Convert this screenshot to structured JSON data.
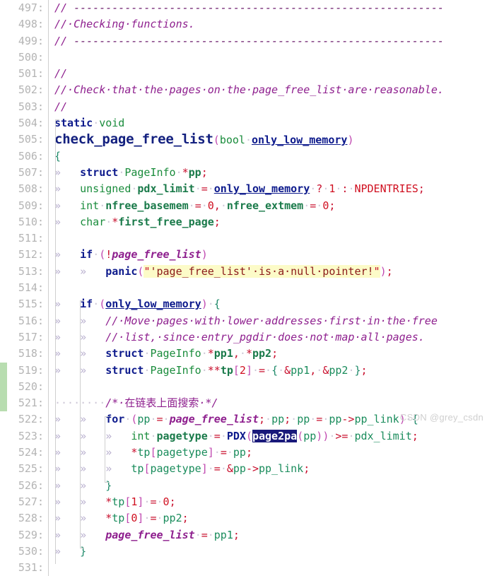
{
  "app": {
    "kind": "code-editor",
    "language": "C",
    "watermark": "CSDN @grey_csdn",
    "theme": {
      "background": "#ffffff",
      "line_number_color": "#b4b4b4",
      "comment_color": "#8e1f8e",
      "keyword_color": "#0d1a8c",
      "type_color": "#1a8c3c",
      "macro_color": "#d01020",
      "string_color": "#8b1a1a",
      "string_background": "#fcfbc8",
      "selection_background": "#19197a",
      "selection_foreground": "#ffffff",
      "change_marker_color": "#b8ddb0",
      "tab_glyph_color": "#b9b0cf"
    },
    "selection": {
      "text": "page2pa",
      "line": 523
    },
    "whitespace_visible": true,
    "tab_glyph": "»",
    "space_glyph": "·"
  },
  "gutter": {
    "first_line": 497,
    "last_line": 531,
    "separator": ":"
  },
  "change_markers": [
    {
      "from_line": 519,
      "to_line": 521
    }
  ],
  "lines": [
    {
      "n": 497,
      "tokens": [
        {
          "t": "// ",
          "c": "cm"
        },
        {
          "t": "----------------------------------------------------------",
          "c": "cm-dash"
        }
      ]
    },
    {
      "n": 498,
      "tokens": [
        {
          "t": "//·Checking·functions.",
          "c": "cm"
        }
      ]
    },
    {
      "n": 499,
      "tokens": [
        {
          "t": "// ",
          "c": "cm"
        },
        {
          "t": "----------------------------------------------------------",
          "c": "cm-dash"
        }
      ]
    },
    {
      "n": 500,
      "tokens": []
    },
    {
      "n": 501,
      "tokens": [
        {
          "t": "//",
          "c": "cm"
        }
      ]
    },
    {
      "n": 502,
      "tokens": [
        {
          "t": "//·Check·that·the·pages·on·the·page_free_list·are·reasonable.",
          "c": "cm"
        }
      ]
    },
    {
      "n": 503,
      "tokens": [
        {
          "t": "//",
          "c": "cm"
        }
      ]
    },
    {
      "n": 504,
      "tokens": [
        {
          "t": "static",
          "c": "kw"
        },
        {
          "t": "·",
          "c": "dot"
        },
        {
          "t": "void",
          "c": "ty"
        }
      ]
    },
    {
      "n": 505,
      "big": true,
      "tokens": [
        {
          "t": "check_page_free_list",
          "c": "fnbig"
        },
        {
          "t": "(",
          "c": "pn"
        },
        {
          "t": "bool",
          "c": "ty"
        },
        {
          "t": "·",
          "c": "dot"
        },
        {
          "t": "only_low_memory",
          "c": "pm"
        },
        {
          "t": ")",
          "c": "pn"
        }
      ]
    },
    {
      "n": 506,
      "tokens": [
        {
          "t": "{",
          "c": "br"
        }
      ]
    },
    {
      "n": 507,
      "indent": 1,
      "tokens": [
        {
          "t": "struct",
          "c": "kw"
        },
        {
          "t": "·",
          "c": "dot"
        },
        {
          "t": "PageInfo",
          "c": "ty"
        },
        {
          "t": "·",
          "c": "dot"
        },
        {
          "t": "*",
          "c": "op"
        },
        {
          "t": "pp",
          "c": "vr"
        },
        {
          "t": ";",
          "c": "op"
        }
      ]
    },
    {
      "n": 508,
      "indent": 1,
      "tokens": [
        {
          "t": "unsigned",
          "c": "ty"
        },
        {
          "t": "·",
          "c": "dot"
        },
        {
          "t": "pdx_limit",
          "c": "vr"
        },
        {
          "t": "·",
          "c": "dot"
        },
        {
          "t": "=",
          "c": "op"
        },
        {
          "t": "·",
          "c": "dot"
        },
        {
          "t": "only_low_memory",
          "c": "pm"
        },
        {
          "t": "·",
          "c": "dot"
        },
        {
          "t": "?",
          "c": "op"
        },
        {
          "t": "·",
          "c": "dot"
        },
        {
          "t": "1",
          "c": "num"
        },
        {
          "t": "·",
          "c": "dot"
        },
        {
          "t": ":",
          "c": "op"
        },
        {
          "t": "·",
          "c": "dot"
        },
        {
          "t": "NPDENTRIES",
          "c": "mac"
        },
        {
          "t": ";",
          "c": "op"
        }
      ]
    },
    {
      "n": 509,
      "indent": 1,
      "tokens": [
        {
          "t": "int",
          "c": "ty"
        },
        {
          "t": "·",
          "c": "dot"
        },
        {
          "t": "nfree_basemem",
          "c": "vr"
        },
        {
          "t": "·",
          "c": "dot"
        },
        {
          "t": "=",
          "c": "op"
        },
        {
          "t": "·",
          "c": "dot"
        },
        {
          "t": "0",
          "c": "num"
        },
        {
          "t": ",",
          "c": "op"
        },
        {
          "t": "·",
          "c": "dot"
        },
        {
          "t": "nfree_extmem",
          "c": "vr"
        },
        {
          "t": "·",
          "c": "dot"
        },
        {
          "t": "=",
          "c": "op"
        },
        {
          "t": "·",
          "c": "dot"
        },
        {
          "t": "0",
          "c": "num"
        },
        {
          "t": ";",
          "c": "op"
        }
      ]
    },
    {
      "n": 510,
      "indent": 1,
      "tokens": [
        {
          "t": "char",
          "c": "ty"
        },
        {
          "t": "·",
          "c": "dot"
        },
        {
          "t": "*",
          "c": "op"
        },
        {
          "t": "first_free_page",
          "c": "vr"
        },
        {
          "t": ";",
          "c": "op"
        }
      ]
    },
    {
      "n": 511,
      "tokens": []
    },
    {
      "n": 512,
      "indent": 1,
      "tokens": [
        {
          "t": "if",
          "c": "kw"
        },
        {
          "t": "·",
          "c": "dot"
        },
        {
          "t": "(",
          "c": "pn"
        },
        {
          "t": "!",
          "c": "op"
        },
        {
          "t": "page_free_list",
          "c": "gv"
        },
        {
          "t": ")",
          "c": "pn"
        }
      ]
    },
    {
      "n": 513,
      "indent": 2,
      "tokens": [
        {
          "t": "panic",
          "c": "fn"
        },
        {
          "t": "(",
          "c": "pn"
        },
        {
          "t": "\"",
          "c": "strq"
        },
        {
          "t": "'page_free_list'·is·a·null·pointer!",
          "c": "str"
        },
        {
          "t": "\"",
          "c": "strq"
        },
        {
          "t": ")",
          "c": "pn"
        },
        {
          "t": ";",
          "c": "op"
        }
      ]
    },
    {
      "n": 514,
      "tokens": []
    },
    {
      "n": 515,
      "indent": 1,
      "tokens": [
        {
          "t": "if",
          "c": "kw"
        },
        {
          "t": "·",
          "c": "dot"
        },
        {
          "t": "(",
          "c": "pn"
        },
        {
          "t": "only_low_memory",
          "c": "pm"
        },
        {
          "t": ")",
          "c": "pn"
        },
        {
          "t": "·",
          "c": "dot"
        },
        {
          "t": "{",
          "c": "br"
        }
      ]
    },
    {
      "n": 516,
      "indent": 2,
      "tokens": [
        {
          "t": "//·Move·pages·with·lower·addresses·first·in·the·free",
          "c": "cm"
        }
      ]
    },
    {
      "n": 517,
      "indent": 2,
      "tokens": [
        {
          "t": "//·list,·since·entry_pgdir·does·not·map·all·pages.",
          "c": "cm"
        }
      ]
    },
    {
      "n": 518,
      "indent": 2,
      "tokens": [
        {
          "t": "struct",
          "c": "kw"
        },
        {
          "t": "·",
          "c": "dot"
        },
        {
          "t": "PageInfo",
          "c": "ty"
        },
        {
          "t": "·",
          "c": "dot"
        },
        {
          "t": "*",
          "c": "op"
        },
        {
          "t": "pp1",
          "c": "vr"
        },
        {
          "t": ",",
          "c": "op"
        },
        {
          "t": "·",
          "c": "dot"
        },
        {
          "t": "*",
          "c": "op"
        },
        {
          "t": "pp2",
          "c": "vr"
        },
        {
          "t": ";",
          "c": "op"
        }
      ]
    },
    {
      "n": 519,
      "indent": 2,
      "tokens": [
        {
          "t": "struct",
          "c": "kw"
        },
        {
          "t": "·",
          "c": "dot"
        },
        {
          "t": "PageInfo",
          "c": "ty"
        },
        {
          "t": "·",
          "c": "dot"
        },
        {
          "t": "**",
          "c": "op"
        },
        {
          "t": "tp",
          "c": "vr"
        },
        {
          "t": "[",
          "c": "pn"
        },
        {
          "t": "2",
          "c": "num"
        },
        {
          "t": "]",
          "c": "pn"
        },
        {
          "t": "·",
          "c": "dot"
        },
        {
          "t": "=",
          "c": "op"
        },
        {
          "t": "·",
          "c": "dot"
        },
        {
          "t": "{",
          "c": "br"
        },
        {
          "t": "·",
          "c": "dot"
        },
        {
          "t": "&",
          "c": "op"
        },
        {
          "t": "pp1",
          "c": "id"
        },
        {
          "t": ",",
          "c": "op"
        },
        {
          "t": "·",
          "c": "dot"
        },
        {
          "t": "&",
          "c": "op"
        },
        {
          "t": "pp2",
          "c": "id"
        },
        {
          "t": "·",
          "c": "dot"
        },
        {
          "t": "}",
          "c": "br"
        },
        {
          "t": ";",
          "c": "op"
        }
      ]
    },
    {
      "n": 520,
      "tokens": []
    },
    {
      "n": 521,
      "raw_indent": true,
      "tokens": [
        {
          "t": "········",
          "c": "dot"
        },
        {
          "t": "/*·",
          "c": "cm"
        },
        {
          "t": "在链表上面搜索",
          "c": "cjk"
        },
        {
          "t": "·*/",
          "c": "cm"
        }
      ]
    },
    {
      "n": 522,
      "indent": 2,
      "tokens": [
        {
          "t": "for",
          "c": "kw"
        },
        {
          "t": "·",
          "c": "dot"
        },
        {
          "t": "(",
          "c": "pn"
        },
        {
          "t": "pp",
          "c": "id"
        },
        {
          "t": "·",
          "c": "dot"
        },
        {
          "t": "=",
          "c": "op"
        },
        {
          "t": "·",
          "c": "dot"
        },
        {
          "t": "page_free_list",
          "c": "gv"
        },
        {
          "t": ";",
          "c": "op"
        },
        {
          "t": "·",
          "c": "dot"
        },
        {
          "t": "pp",
          "c": "id"
        },
        {
          "t": ";",
          "c": "op"
        },
        {
          "t": "·",
          "c": "dot"
        },
        {
          "t": "pp",
          "c": "id"
        },
        {
          "t": "·",
          "c": "dot"
        },
        {
          "t": "=",
          "c": "op"
        },
        {
          "t": "·",
          "c": "dot"
        },
        {
          "t": "pp",
          "c": "id"
        },
        {
          "t": "->",
          "c": "op"
        },
        {
          "t": "pp_link",
          "c": "id"
        },
        {
          "t": ")",
          "c": "pn"
        },
        {
          "t": "·",
          "c": "dot"
        },
        {
          "t": "{",
          "c": "br"
        }
      ]
    },
    {
      "n": 523,
      "indent": 3,
      "tokens": [
        {
          "t": "int",
          "c": "ty"
        },
        {
          "t": "·",
          "c": "dot"
        },
        {
          "t": "pagetype",
          "c": "vr"
        },
        {
          "t": "·",
          "c": "dot"
        },
        {
          "t": "=",
          "c": "op"
        },
        {
          "t": "·",
          "c": "dot"
        },
        {
          "t": "PDX",
          "c": "fn"
        },
        {
          "t": "(",
          "c": "pn"
        },
        {
          "t": "page2pa",
          "c": "sel"
        },
        {
          "t": "(",
          "c": "pn"
        },
        {
          "t": "pp",
          "c": "id"
        },
        {
          "t": ")",
          "c": "pn"
        },
        {
          "t": ")",
          "c": "pn"
        },
        {
          "t": "·",
          "c": "dot"
        },
        {
          "t": ">=",
          "c": "op"
        },
        {
          "t": "·",
          "c": "dot"
        },
        {
          "t": "pdx_limit",
          "c": "id"
        },
        {
          "t": ";",
          "c": "op"
        }
      ]
    },
    {
      "n": 524,
      "indent": 3,
      "tokens": [
        {
          "t": "*",
          "c": "op"
        },
        {
          "t": "tp",
          "c": "id"
        },
        {
          "t": "[",
          "c": "pn"
        },
        {
          "t": "pagetype",
          "c": "id"
        },
        {
          "t": "]",
          "c": "pn"
        },
        {
          "t": "·",
          "c": "dot"
        },
        {
          "t": "=",
          "c": "op"
        },
        {
          "t": "·",
          "c": "dot"
        },
        {
          "t": "pp",
          "c": "id"
        },
        {
          "t": ";",
          "c": "op"
        }
      ]
    },
    {
      "n": 525,
      "indent": 3,
      "tokens": [
        {
          "t": "tp",
          "c": "id"
        },
        {
          "t": "[",
          "c": "pn"
        },
        {
          "t": "pagetype",
          "c": "id"
        },
        {
          "t": "]",
          "c": "pn"
        },
        {
          "t": "·",
          "c": "dot"
        },
        {
          "t": "=",
          "c": "op"
        },
        {
          "t": "·",
          "c": "dot"
        },
        {
          "t": "&",
          "c": "op"
        },
        {
          "t": "pp",
          "c": "id"
        },
        {
          "t": "->",
          "c": "op"
        },
        {
          "t": "pp_link",
          "c": "id"
        },
        {
          "t": ";",
          "c": "op"
        }
      ]
    },
    {
      "n": 526,
      "indent": 2,
      "tokens": [
        {
          "t": "}",
          "c": "br"
        }
      ]
    },
    {
      "n": 527,
      "indent": 2,
      "tokens": [
        {
          "t": "*",
          "c": "op"
        },
        {
          "t": "tp",
          "c": "id"
        },
        {
          "t": "[",
          "c": "pn"
        },
        {
          "t": "1",
          "c": "num"
        },
        {
          "t": "]",
          "c": "pn"
        },
        {
          "t": "·",
          "c": "dot"
        },
        {
          "t": "=",
          "c": "op"
        },
        {
          "t": "·",
          "c": "dot"
        },
        {
          "t": "0",
          "c": "num"
        },
        {
          "t": ";",
          "c": "op"
        }
      ]
    },
    {
      "n": 528,
      "indent": 2,
      "tokens": [
        {
          "t": "*",
          "c": "op"
        },
        {
          "t": "tp",
          "c": "id"
        },
        {
          "t": "[",
          "c": "pn"
        },
        {
          "t": "0",
          "c": "num"
        },
        {
          "t": "]",
          "c": "pn"
        },
        {
          "t": "·",
          "c": "dot"
        },
        {
          "t": "=",
          "c": "op"
        },
        {
          "t": "·",
          "c": "dot"
        },
        {
          "t": "pp2",
          "c": "id"
        },
        {
          "t": ";",
          "c": "op"
        }
      ]
    },
    {
      "n": 529,
      "indent": 2,
      "tokens": [
        {
          "t": "page_free_list",
          "c": "gv"
        },
        {
          "t": "·",
          "c": "dot"
        },
        {
          "t": "=",
          "c": "op"
        },
        {
          "t": "·",
          "c": "dot"
        },
        {
          "t": "pp1",
          "c": "id"
        },
        {
          "t": ";",
          "c": "op"
        }
      ]
    },
    {
      "n": 530,
      "indent": 1,
      "tokens": [
        {
          "t": "}",
          "c": "br"
        }
      ]
    },
    {
      "n": 531,
      "tokens": []
    }
  ]
}
